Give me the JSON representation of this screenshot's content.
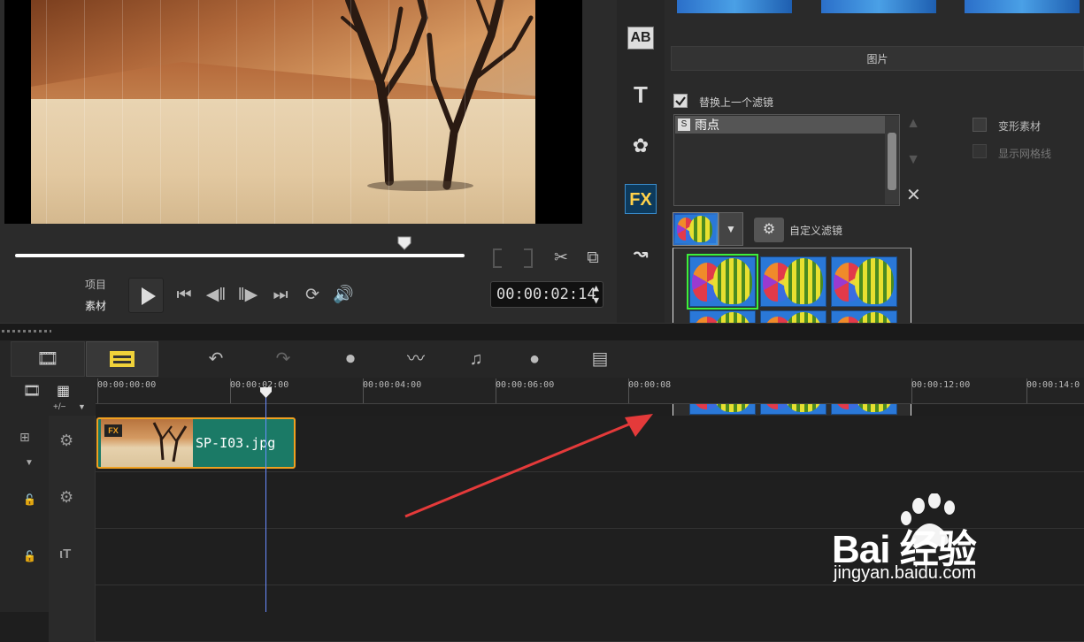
{
  "player": {
    "mode_project": "项目",
    "mode_clip": "素材",
    "timecode": "00:00:02:14"
  },
  "side_tools": [
    "media-icon",
    "transition-icon",
    "title-icon",
    "graphic-icon",
    "filter-icon",
    "path-icon"
  ],
  "options": {
    "tab_photo": "图片",
    "replace_last_filter": "替换上一个滤镜",
    "replace_last_filter_checked": true,
    "filter_list": [
      "雨点"
    ],
    "distort_clip": "变形素材",
    "show_grid": "显示网格线",
    "custom_filter": "自定义滤镜"
  },
  "gallery": {
    "rows": 4,
    "cols": 3,
    "selected_index": 0
  },
  "timeline": {
    "add_remove": "+/−",
    "ruler": [
      "00:00:00:00",
      "00:00:02:00",
      "00:00:04:00",
      "00:00:06:00",
      "00:00:08",
      "00:00:12:00",
      "00:00:14:0"
    ],
    "clip": {
      "name": "SP-I03.jpg",
      "fx": "FX"
    },
    "playhead_time": "00:00:02:14"
  },
  "watermark": {
    "logo": "Bai 经验",
    "url": "jingyan.baidu.com"
  },
  "colors": {
    "accent": "#3cf03c",
    "clip": "#1b7a66",
    "clip_border": "#f0a020",
    "arrow": "#e43a3a"
  }
}
